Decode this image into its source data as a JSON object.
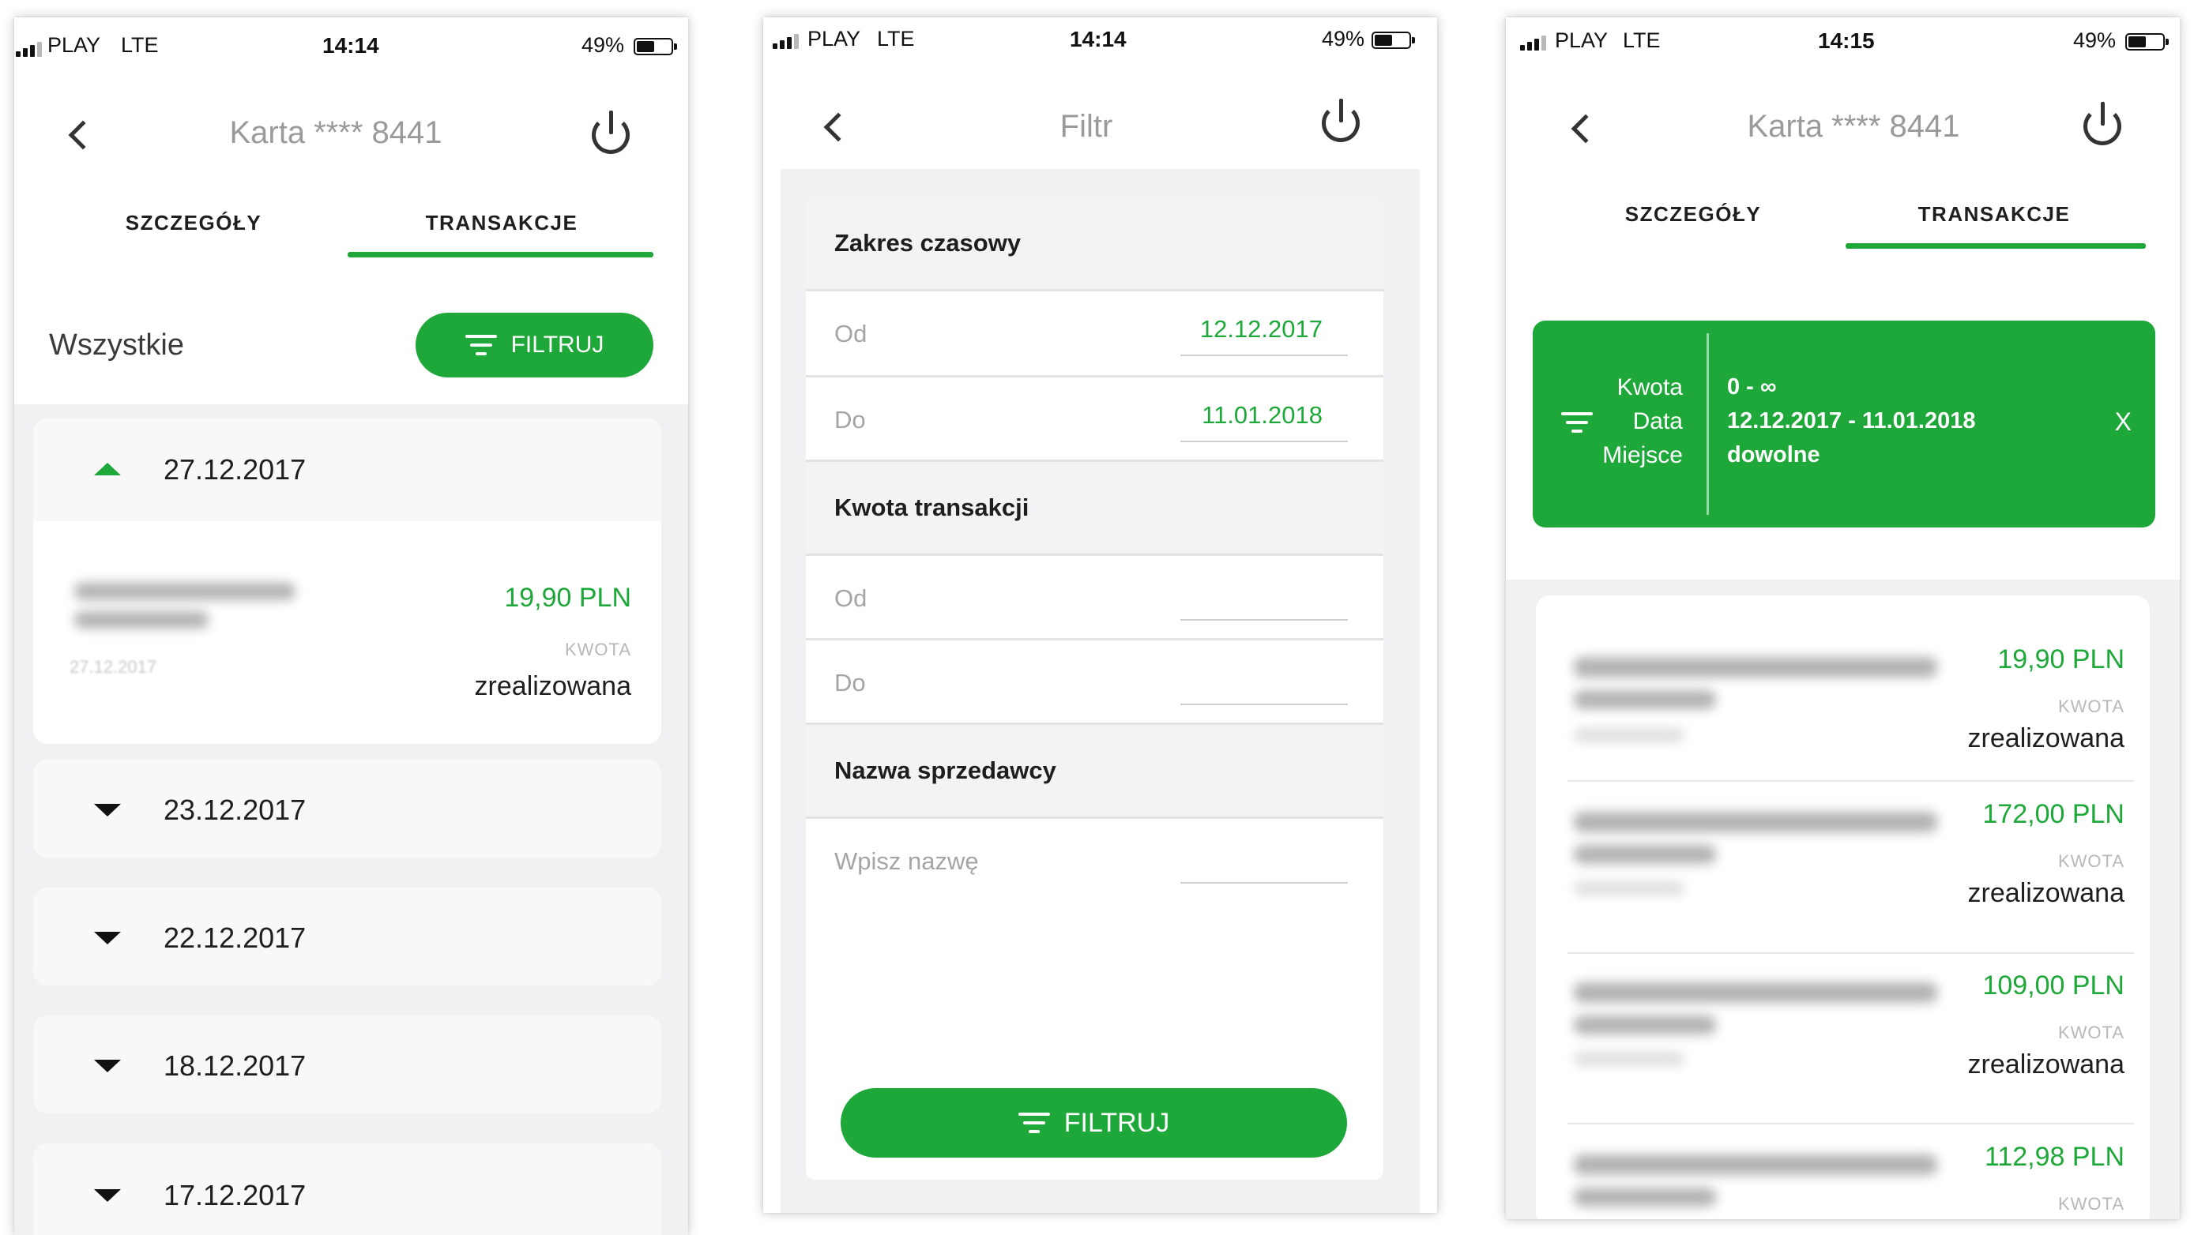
{
  "status": {
    "carrier": "PLAY",
    "network": "LTE",
    "battery": "49%",
    "time1": "14:14",
    "time2": "14:14",
    "time3": "14:15"
  },
  "screen1": {
    "title": "Karta **** 8441",
    "tabs": [
      "SZCZEGÓŁY",
      "TRANSAKCJE"
    ],
    "filter_label": "Wszystkie",
    "filter_button": "FILTRUJ",
    "expanded_date": "27.12.2017",
    "transaction": {
      "amount": "19,90 PLN",
      "amount_label": "KWOTA",
      "status": "zrealizowana",
      "date": "27.12.2017"
    },
    "dates": [
      "23.12.2017",
      "22.12.2017",
      "18.12.2017",
      "17.12.2017"
    ]
  },
  "screen2": {
    "title": "Filtr",
    "section_time": "Zakres czasowy",
    "from_label": "Od",
    "from_value": "12.12.2017",
    "to_label": "Do",
    "to_value": "11.01.2018",
    "section_amount": "Kwota transakcji",
    "amount_from_label": "Od",
    "amount_to_label": "Do",
    "section_seller": "Nazwa sprzedawcy",
    "seller_placeholder": "Wpisz nazwę",
    "filter_button": "FILTRUJ"
  },
  "screen3": {
    "title": "Karta **** 8441",
    "tabs": [
      "SZCZEGÓŁY",
      "TRANSAKCJE"
    ],
    "summary": {
      "labels": [
        "Kwota",
        "Data",
        "Miejsce"
      ],
      "values": [
        "0 - ∞",
        "12.12.2017 - 11.01.2018",
        "dowolne"
      ],
      "close": "X"
    },
    "transactions": [
      {
        "amount": "19,90 PLN",
        "label": "KWOTA",
        "status": "zrealizowana"
      },
      {
        "amount": "172,00 PLN",
        "label": "KWOTA",
        "status": "zrealizowana"
      },
      {
        "amount": "109,00 PLN",
        "label": "KWOTA",
        "status": "zrealizowana"
      },
      {
        "amount": "112,98 PLN",
        "label": "KWOTA",
        "status": ""
      }
    ]
  },
  "icons": {
    "back": "chevron-left-icon",
    "power": "power-icon",
    "filter": "filter-lines-icon",
    "expand": "triangle-up-icon",
    "collapse": "triangle-down-icon"
  },
  "colors": {
    "accent": "#1ea83a",
    "title_gray": "#9a9a9a",
    "background_gray": "#f1f1f3"
  }
}
